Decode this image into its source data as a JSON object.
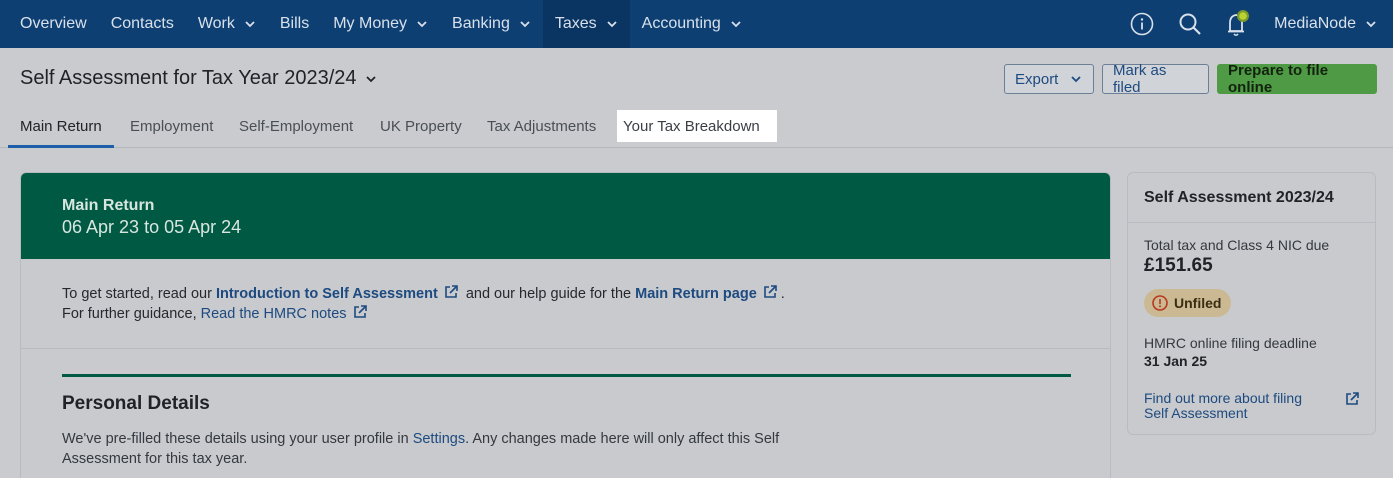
{
  "nav": {
    "items": [
      {
        "label": "Overview",
        "dropdown": false
      },
      {
        "label": "Contacts",
        "dropdown": false
      },
      {
        "label": "Work",
        "dropdown": true
      },
      {
        "label": "Bills",
        "dropdown": false
      },
      {
        "label": "My Money",
        "dropdown": true
      },
      {
        "label": "Banking",
        "dropdown": true
      },
      {
        "label": "Taxes",
        "dropdown": true,
        "active": true
      },
      {
        "label": "Accounting",
        "dropdown": true
      }
    ],
    "user": "MediaNode",
    "icons": [
      "info-icon",
      "search-icon",
      "bell-icon"
    ],
    "notification_dot_color": "#b7d432"
  },
  "header": {
    "title": "Self Assessment for Tax Year 2023/24",
    "export": "Export",
    "mark_filed": "Mark as filed",
    "prepare": "Prepare to file online"
  },
  "tabs": [
    "Main Return",
    "Employment",
    "Self-Employment",
    "UK Property",
    "Tax Adjustments",
    "Your Tax Breakdown"
  ],
  "main": {
    "head_title": "Main Return",
    "head_period": "06 Apr 23 to 05 Apr 24",
    "intro": {
      "t1": "To get started, read our",
      "link1": "Introduction to Self Assessment",
      "t2": "and our help guide for the",
      "link2": "Main Return page",
      "t3": ".",
      "t4": "For further guidance,",
      "link3": "Read the HMRC notes"
    },
    "personal": {
      "title": "Personal Details",
      "desc1": "We've pre-filled these details using your user profile in",
      "settings": "Settings",
      "desc2": ". Any changes made here will only affect this Self Assessment for this tax year."
    }
  },
  "side": {
    "title": "Self Assessment 2023/24",
    "due_label": "Total tax and Class 4 NIC due",
    "due_amount": "£151.65",
    "status": "Unfiled",
    "deadline_label": "HMRC online filing deadline",
    "deadline": "31 Jan 25",
    "more_link": "Find out more about filing Self Assessment"
  },
  "colors": {
    "nav_bg": "#0d3f73",
    "green_header": "#005a43",
    "primary_button": "#4f9a45",
    "link": "#1d4a80",
    "badge": "#cbb994"
  }
}
